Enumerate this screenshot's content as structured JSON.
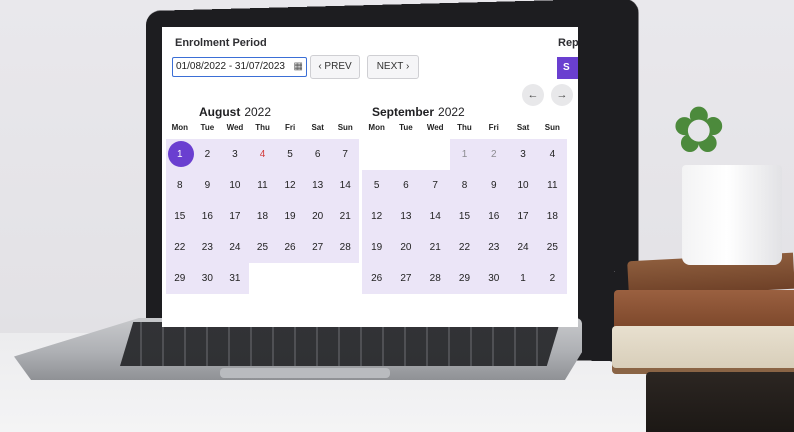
{
  "form": {
    "period_label": "Enrolment Period",
    "date_range_value": "01/08/2022 - 31/07/2023",
    "prev_label": "‹ PREV",
    "next_label": "NEXT ›",
    "rep_label": "Rep",
    "purple_button_label": "S"
  },
  "nav": {
    "left_arrow": "←",
    "right_arrow": "→"
  },
  "weekdays": [
    "Mon",
    "Tue",
    "Wed",
    "Thu",
    "Fri",
    "Sat",
    "Sun"
  ],
  "months": [
    {
      "name": "August",
      "year": "2022",
      "days": [
        "1",
        "2",
        "3",
        "4",
        "5",
        "6",
        "7",
        "8",
        "9",
        "10",
        "11",
        "12",
        "13",
        "14",
        "15",
        "16",
        "17",
        "18",
        "19",
        "20",
        "21",
        "22",
        "23",
        "24",
        "25",
        "26",
        "27",
        "28",
        "29",
        "30",
        "31",
        "",
        "",
        "",
        "",
        "",
        ""
      ],
      "selected_day": "1",
      "highlight_red_day": "4"
    },
    {
      "name": "September",
      "year": "2022",
      "days": [
        "",
        "",
        "",
        "1",
        "2",
        "3",
        "4",
        "5",
        "6",
        "7",
        "8",
        "9",
        "10",
        "11",
        "12",
        "13",
        "14",
        "15",
        "16",
        "17",
        "18",
        "19",
        "20",
        "21",
        "22",
        "23",
        "24",
        "25",
        "26",
        "27",
        "28",
        "29",
        "30",
        "1",
        "2"
      ],
      "faded_days": [
        "1",
        "2"
      ]
    }
  ],
  "colors": {
    "accent": "#6a3fd0",
    "range_bg": "#ebe5f7",
    "today_red": "#d23a3a"
  }
}
